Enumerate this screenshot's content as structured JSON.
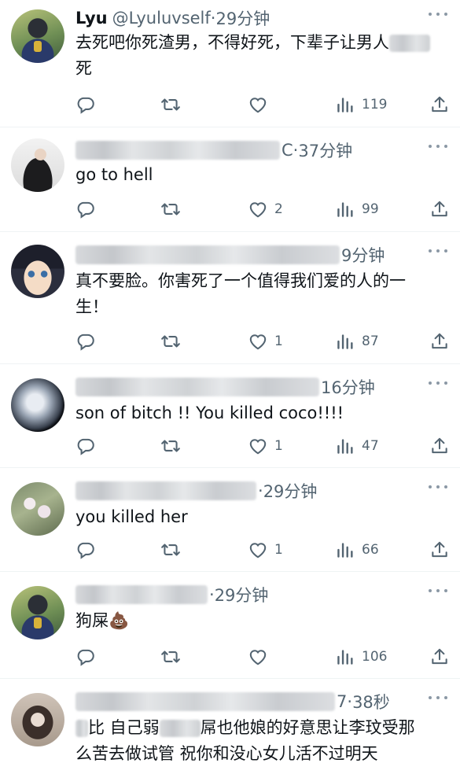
{
  "colors": {
    "text": "#0f1419",
    "secondary": "#536471",
    "divider": "#eff3f4"
  },
  "tweets": [
    {
      "name": "Lyu",
      "handle": "@Lyuluvself",
      "sep": "·",
      "time": "29分钟",
      "text_a": "去死吧你死渣男，不得好死，下辈子让男人",
      "text_b": "死",
      "reply": "",
      "retweet": "",
      "like": "",
      "views": "119",
      "reply_icon": "reply-icon",
      "retweet_icon": "retweet-icon",
      "like_icon": "heart-icon",
      "views_icon": "views-icon",
      "share_icon": "share-icon"
    },
    {
      "name_tail": "C",
      "sep": "·",
      "time": "37分钟",
      "text": "go to hell",
      "like": "2",
      "views": "99"
    },
    {
      "time": "9分钟",
      "text": "真不要脸。你害死了一个值得我们爱的人的一生！",
      "like": "1",
      "views": "87"
    },
    {
      "time": "16分钟",
      "text": "son of bitch !! You killed coco!!!!",
      "like": "1",
      "views": "47"
    },
    {
      "sep": "·",
      "time": "29分钟",
      "text": "you killed her",
      "like": "1",
      "views": "66"
    },
    {
      "sep": "·",
      "time": "29分钟",
      "text": "狗屎💩",
      "like": "",
      "views": "106"
    },
    {
      "name_tail": "7",
      "sep": "·",
      "time": "38秒",
      "text_a": "比 自己弱",
      "text_b": "屌也他娘的好意思让李玟受那",
      "text_c": "么苦去做试管 祝你和没心女儿活不过明天"
    }
  ]
}
